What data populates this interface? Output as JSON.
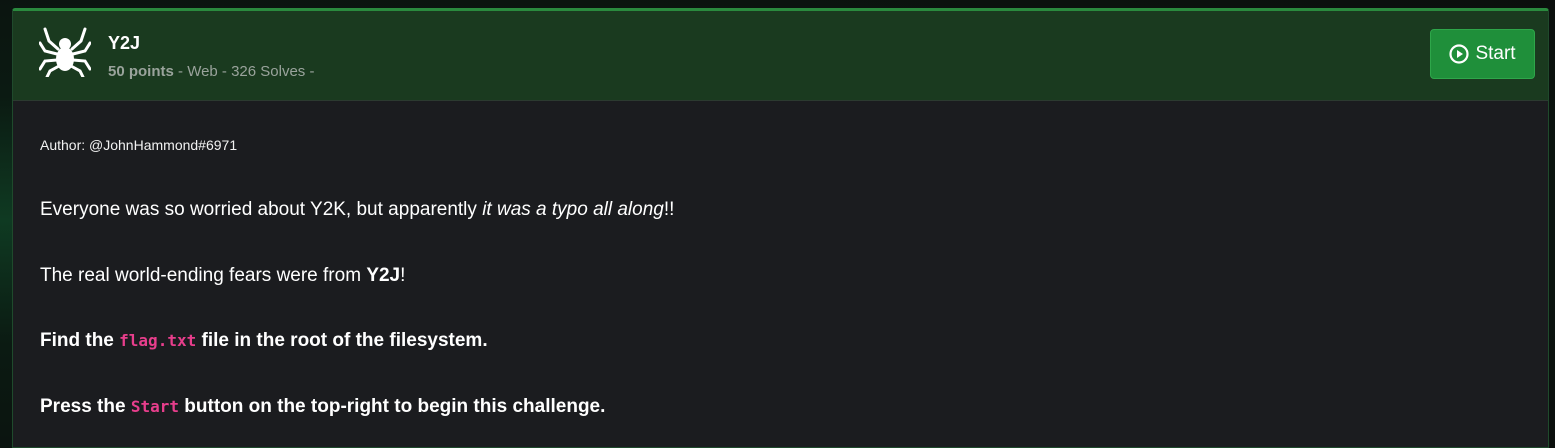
{
  "challenge": {
    "title": "Y2J",
    "points": "50 points",
    "category_solves": " - Web - 326 Solves -",
    "start_label": "Start",
    "logo_icon": "spider-icon",
    "start_icon": "play-circle-icon"
  },
  "description": {
    "author": "Author: @JohnHammond#6971",
    "p1_before": "Everyone was so worried about Y2K, but apparently ",
    "p1_italic": "it was a typo all along",
    "p1_after": "!!",
    "p2_before": "The real world-ending fears were from ",
    "p2_bold": "Y2J",
    "p2_after": "!",
    "p3_before": "Find the ",
    "p3_code": "flag.txt",
    "p3_after": " file in the root of the filesystem.",
    "p4_before": "Press the ",
    "p4_code": "Start",
    "p4_after": " button on the top-right to begin this challenge."
  },
  "colors": {
    "header_bg": "#1a3a1f",
    "accent": "#2a8a3e",
    "button_bg": "#1f8f3a",
    "body_bg": "#1b1c1f",
    "code": "#e83e8c"
  }
}
